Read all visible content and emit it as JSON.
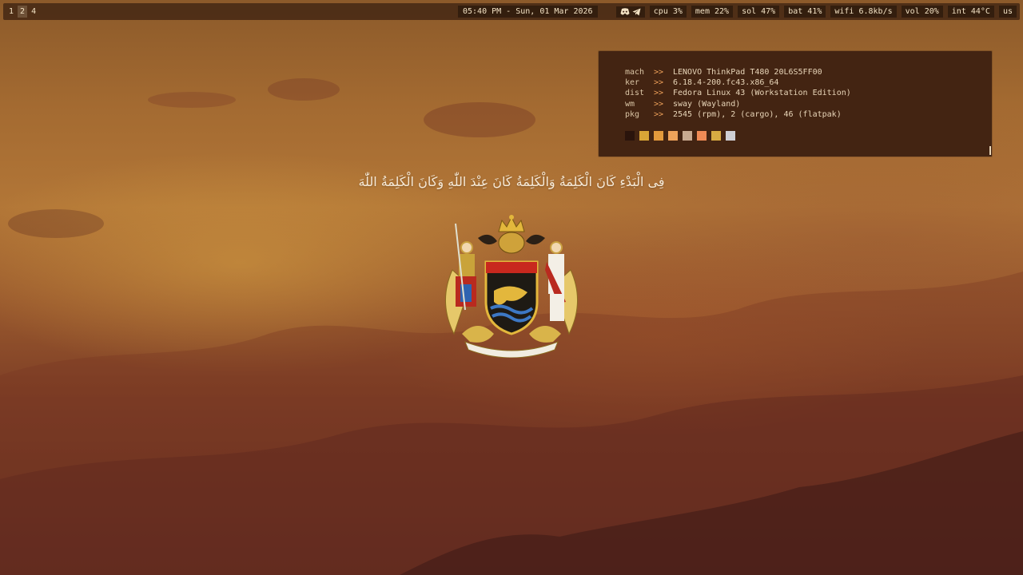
{
  "workspaces": [
    {
      "label": "1",
      "active": false
    },
    {
      "label": "2",
      "active": true
    },
    {
      "label": "4",
      "active": false
    }
  ],
  "clock": "05:40 PM - Sun, 01 Mar 2026",
  "status": {
    "icons": [
      "discord-icon",
      "telegram-icon"
    ],
    "cpu": "cpu 3%",
    "mem": "mem 22%",
    "sol": "sol 47%",
    "bat": "bat 41%",
    "wifi": "wifi 6.8kb/s",
    "vol": "vol 20%",
    "temp": "int 44°C",
    "layout": "us"
  },
  "fetch": {
    "rows": [
      {
        "key": "mach",
        "arrow": ">>",
        "value": "LENOVO ThinkPad T480 20L6S5FF00"
      },
      {
        "key": "ker",
        "arrow": ">>",
        "value": "6.18.4-200.fc43.x86_64"
      },
      {
        "key": "dist",
        "arrow": ">>",
        "value": "Fedora Linux 43 (Workstation Edition)"
      },
      {
        "key": "wm",
        "arrow": ">>",
        "value": "sway (Wayland)"
      },
      {
        "key": "pkg",
        "arrow": ">>",
        "value": "2545 (rpm), 2 (cargo), 46 (flatpak)"
      }
    ],
    "swatches": [
      "#2a140c",
      "#d9a636",
      "#e39a3c",
      "#eea35a",
      "#c8aa90",
      "#f08b55",
      "#d8ab42",
      "#cfcfd4"
    ]
  },
  "wallpaper": {
    "verse": "فِى الْبَدْءِ كَانَ الْكَلِمَةُ وَالْكَلِمَةُ كَانَ عِنْدَ اللّٰهِ وَكَانَ الْكَلِمَةُ اللّٰهَ",
    "emblem": "coat-of-arms-emblem"
  },
  "colors": {
    "bar_bg": "#3e2212",
    "panel_bg": "#432412",
    "accent": "#f0a25a",
    "text": "#f3e2c4"
  }
}
